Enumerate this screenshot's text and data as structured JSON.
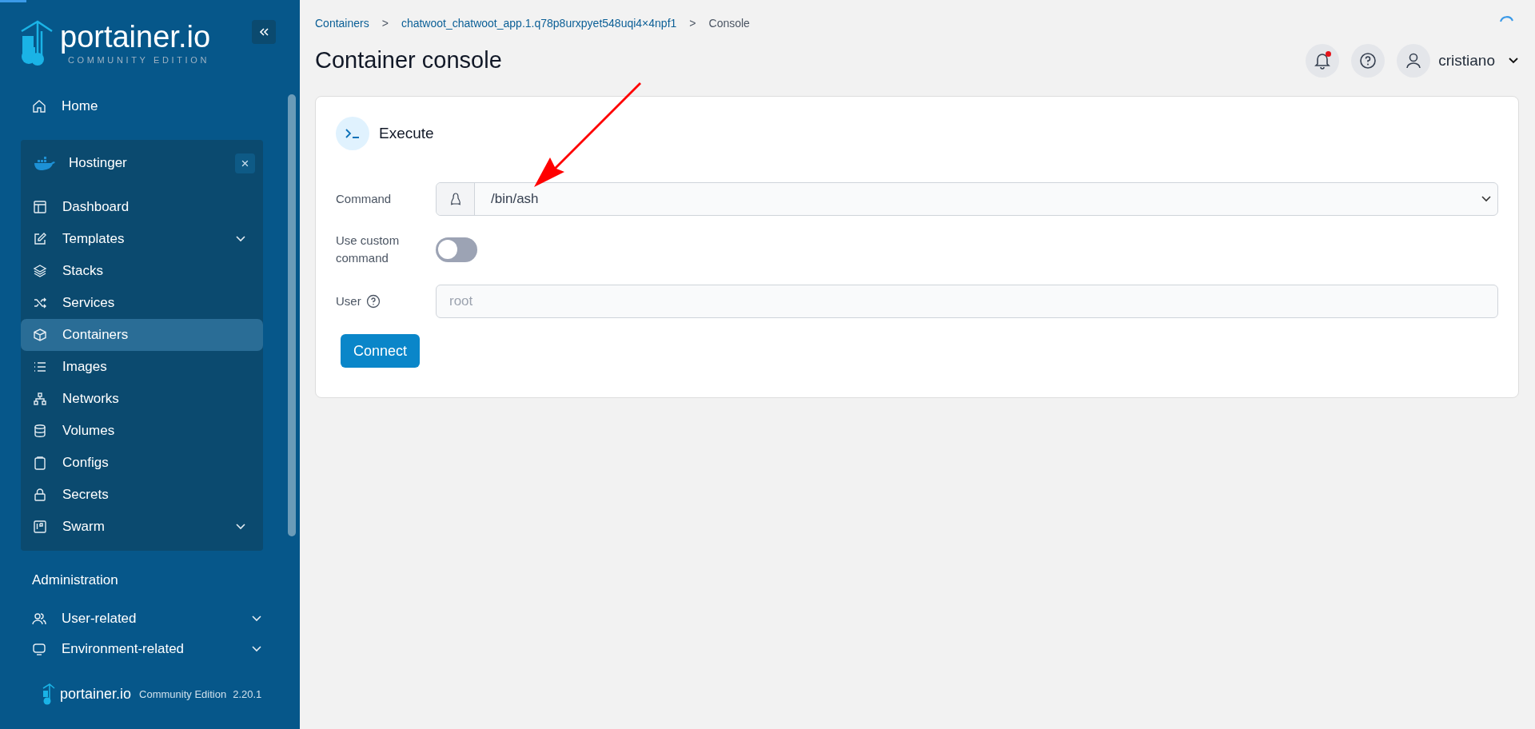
{
  "sidebar": {
    "logo": {
      "name": "portainer.io",
      "edition": "COMMUNITY EDITION"
    },
    "home": {
      "label": "Home"
    },
    "environment": {
      "name": "Hostinger",
      "close": "×",
      "items": [
        {
          "label": "Dashboard",
          "selected": false,
          "has_submenu": false
        },
        {
          "label": "Templates",
          "selected": false,
          "has_submenu": true
        },
        {
          "label": "Stacks",
          "selected": false,
          "has_submenu": false
        },
        {
          "label": "Services",
          "selected": false,
          "has_submenu": false
        },
        {
          "label": "Containers",
          "selected": true,
          "has_submenu": false
        },
        {
          "label": "Images",
          "selected": false,
          "has_submenu": false
        },
        {
          "label": "Networks",
          "selected": false,
          "has_submenu": false
        },
        {
          "label": "Volumes",
          "selected": false,
          "has_submenu": false
        },
        {
          "label": "Configs",
          "selected": false,
          "has_submenu": false
        },
        {
          "label": "Secrets",
          "selected": false,
          "has_submenu": false
        },
        {
          "label": "Swarm",
          "selected": false,
          "has_submenu": true
        }
      ]
    },
    "section_title": "Administration",
    "admin_items": [
      {
        "label": "User-related",
        "has_submenu": true
      },
      {
        "label": "Environment-related",
        "has_submenu": true
      }
    ],
    "footer": {
      "name": "portainer.io",
      "edition": "Community Edition",
      "version": "2.20.1"
    }
  },
  "breadcrumbs": [
    {
      "label": "Containers",
      "link": true
    },
    {
      "label": "chatwoot_chatwoot_app.1.q78p8urxpyet548uqi4×4npf1",
      "link": true
    },
    {
      "label": "Console",
      "link": false
    }
  ],
  "separator": ">",
  "page_title": "Container console",
  "user": {
    "name": "cristiano",
    "has_notification": true
  },
  "card": {
    "title": "Execute",
    "command": {
      "label": "Command",
      "value": "/bin/ash"
    },
    "custom": {
      "label": "Use custom command",
      "on": false
    },
    "user_field": {
      "label": "User",
      "placeholder": "root"
    },
    "button": "Connect"
  }
}
